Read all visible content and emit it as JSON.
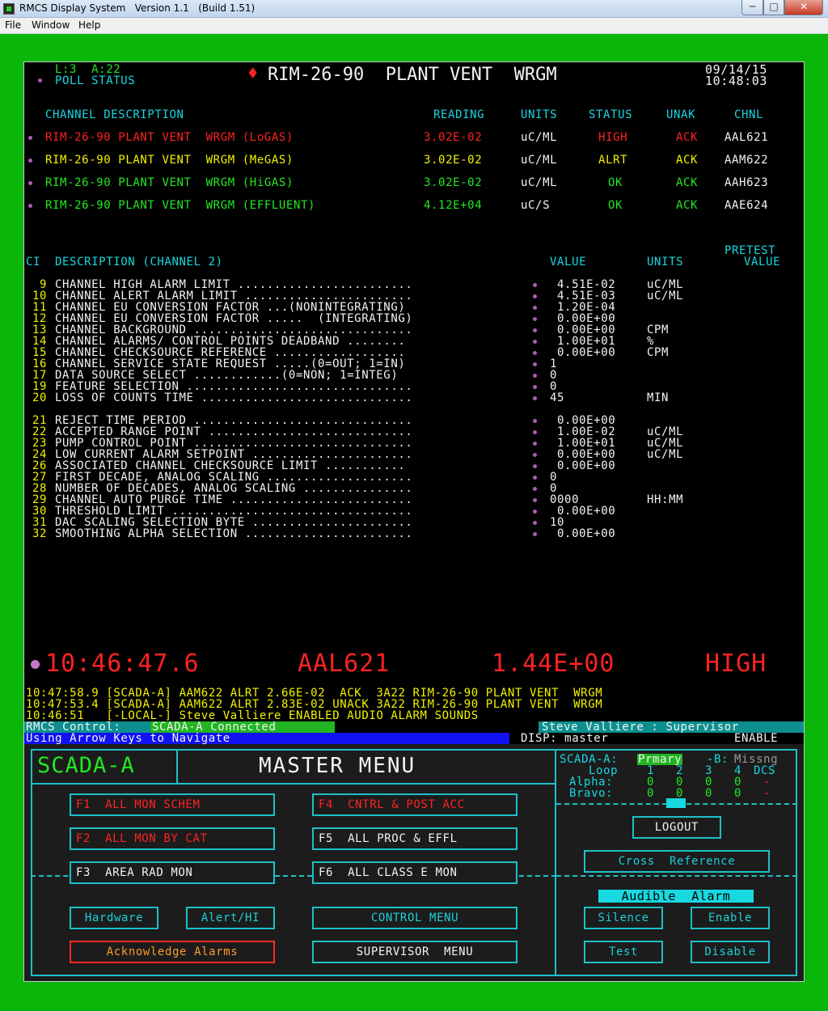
{
  "window": {
    "title": "RMCS Display System   Version 1.1   (Build 1.51)",
    "min": "─",
    "max": "□",
    "close": "✕"
  },
  "menubar": [
    "File",
    "Window",
    "Help"
  ],
  "header": {
    "loc": "L:3  A:22",
    "poll": "POLL STATUS",
    "title": "RIM-26-90  PLANT VENT  WRGM",
    "date": "09/14/15",
    "time": "10:48:03",
    "diamond": "♦"
  },
  "channels": {
    "headers": {
      "desc": "CHANNEL DESCRIPTION",
      "reading": "READING",
      "units": "UNITS",
      "status": "STATUS",
      "unak": "UNAK",
      "chnl": "CHNL"
    },
    "rows": [
      {
        "name": "RIM-26-90 PLANT VENT  WRGM (LoGAS)",
        "reading": "3.02E-02",
        "units": "uC/ML",
        "status": "HIGH",
        "unak": "ACK",
        "chnl": "AAL621",
        "color": "#ff2222"
      },
      {
        "name": "RIM-26-90 PLANT VENT  WRGM (MeGAS)",
        "reading": "3.02E-02",
        "units": "uC/ML",
        "status": "ALRT",
        "unak": "ACK",
        "chnl": "AAM622",
        "color": "#f2f200"
      },
      {
        "name": "RIM-26-90 PLANT VENT  WRGM (HiGAS)",
        "reading": "3.02E-02",
        "units": "uC/ML",
        "status": "OK",
        "unak": "ACK",
        "chnl": "AAH623",
        "color": "#22e822"
      },
      {
        "name": "RIM-26-90 PLANT VENT  WRGM (EFFLUENT)",
        "reading": "4.12E+04",
        "units": "uC/S",
        "status": "OK",
        "unak": "ACK",
        "chnl": "AAE624",
        "color": "#22e822"
      }
    ]
  },
  "ci": {
    "header": {
      "ci": "CI",
      "desc": "DESCRIPTION (CHANNEL 2)",
      "value": "VALUE",
      "units": "UNITS",
      "pretest1": "PRETEST",
      "pretest2": "VALUE"
    },
    "rows": [
      {
        "n": "9",
        "d": "CHANNEL HIGH ALARM LIMIT ........................",
        "v": " 4.51E-02",
        "u": "uC/ML"
      },
      {
        "n": "10",
        "d": "CHANNEL ALERT ALARM LIMIT .......................",
        "v": " 4.51E-03",
        "u": "uC/ML"
      },
      {
        "n": "11",
        "d": "CHANNEL EU CONVERSION FACTOR ...(NONINTEGRATING)",
        "v": " 1.20E-04",
        "u": ""
      },
      {
        "n": "12",
        "d": "CHANNEL EU CONVERSION FACTOR .....  (INTEGRATING)",
        "v": " 0.00E+00",
        "u": ""
      },
      {
        "n": "13",
        "d": "CHANNEL BACKGROUND ..............................",
        "v": " 0.00E+00",
        "u": "CPM"
      },
      {
        "n": "14",
        "d": "CHANNEL ALARMS/ CONTROL POINTS DEADBAND ........",
        "v": " 1.00E+01",
        "u": "%"
      },
      {
        "n": "15",
        "d": "CHANNEL CHECKSOURCE REFERENCE ..................",
        "v": " 0.00E+00",
        "u": "CPM"
      },
      {
        "n": "16",
        "d": "CHANNEL SERVICE STATE REQUEST .....(0=OUT; 1=IN)",
        "v": "1",
        "u": ""
      },
      {
        "n": "17",
        "d": "DATA SOURCE SELECT ............(0=NON; 1=INTEG)",
        "v": "0",
        "u": ""
      },
      {
        "n": "19",
        "d": "FEATURE SELECTION ...............................",
        "v": "0",
        "u": ""
      },
      {
        "n": "20",
        "d": "LOSS OF COUNTS TIME .............................",
        "v": "45",
        "u": "MIN"
      },
      {
        "n": "21",
        "d": "REJECT TIME PERIOD ..............................",
        "v": " 0.00E+00",
        "u": ""
      },
      {
        "n": "22",
        "d": "ACCEPTED RANGE POINT ............................",
        "v": " 1.00E-02",
        "u": "uC/ML"
      },
      {
        "n": "23",
        "d": "PUMP CONTROL POINT ..............................",
        "v": " 1.00E+01",
        "u": "uC/ML"
      },
      {
        "n": "24",
        "d": "LOW CURRENT ALARM SETPOINT ......................",
        "v": " 0.00E+00",
        "u": "uC/ML"
      },
      {
        "n": "26",
        "d": "ASSOCIATED CHANNEL CHECKSOURCE LIMIT ...........",
        "v": " 0.00E+00",
        "u": ""
      },
      {
        "n": "27",
        "d": "FIRST DECADE, ANALOG SCALING ....................",
        "v": "0",
        "u": ""
      },
      {
        "n": "28",
        "d": "NUMBER OF DECADES, ANALOG SCALING ...............",
        "v": "0",
        "u": ""
      },
      {
        "n": "29",
        "d": "CHANNEL AUTO PURGE TIME .........................",
        "v": "0000",
        "u": "HH:MM"
      },
      {
        "n": "30",
        "d": "THRESHOLD LIMIT .................................",
        "v": " 0.00E+00",
        "u": ""
      },
      {
        "n": "31",
        "d": "DAC SCALING SELECTION BYTE ......................",
        "v": "10",
        "u": ""
      },
      {
        "n": "32",
        "d": "SMOOTHING ALPHA SELECTION .......................",
        "v": " 0.00E+00",
        "u": ""
      }
    ]
  },
  "alarm": {
    "time": "10:46:47.6",
    "chnl": "AAL621",
    "value": "1.44E+00",
    "status": "HIGH"
  },
  "log": [
    {
      "text": "10:47:58.9 [SCADA-A] AAM622 ALRT 2.66E-02  ACK  3A22 RIM-26-90 PLANT VENT  WRGM"
    },
    {
      "text": "10:47:53.4 [SCADA-A] AAM622 ALRT 2.83E-02 UNACK 3A22 RIM-26-90 PLANT VENT  WRGM"
    },
    {
      "text": "10:46:51   [-LOCAL-] Steve Valliere ENABLED AUDIO ALARM SOUNDS"
    }
  ],
  "status": {
    "control_label": "RMCS Control:",
    "control_value": "SCADA-A Connected",
    "user": "Steve Valliere : Supervisor",
    "nav": "Using Arrow Keys to Navigate",
    "disp": "DISP: master",
    "enable": "ENABLE"
  },
  "menu": {
    "scada": "SCADA-A",
    "title": "MASTER MENU",
    "scada_status": {
      "a_label": "SCADA-A:",
      "a_value": "Prmary",
      "b_label": "-B:",
      "b_value": "Missng"
    },
    "loop": {
      "label": "Loop",
      "cols": [
        "1",
        "2",
        "3",
        "4"
      ],
      "dcs": "DCS",
      "alpha_label": "Alpha:",
      "alpha": [
        "0",
        "0",
        "0",
        "0",
        "-"
      ],
      "bravo_label": "Bravo:",
      "bravo": [
        "0",
        "0",
        "0",
        "0",
        "-"
      ]
    },
    "f1": "F1  ALL MON SCHEM",
    "f2": "F2  ALL MON BY CAT",
    "f3": "F3  AREA RAD MON",
    "f4": "F4  CNTRL & POST ACC",
    "f5": "F5  ALL PROC & EFFL",
    "f6": "F6  ALL CLASS E MON",
    "logout": "LOGOUT",
    "cross_ref": "Cross  Reference",
    "hardware": "Hardware",
    "alert_hi": "Alert/HI",
    "control_menu": "CONTROL MENU",
    "ack_alarms": "Acknowledge Alarms",
    "supervisor_menu": "SUPERVISOR  MENU",
    "audible": "Audible  Alarm",
    "silence": "Silence",
    "enable": "Enable",
    "test": "Test",
    "disable": "Disable"
  },
  "colors": {
    "frame": "#0ab60a",
    "cyan": "#1cc0c8",
    "red": "#ff2222",
    "yellow": "#f2f200",
    "green": "#22e822"
  }
}
